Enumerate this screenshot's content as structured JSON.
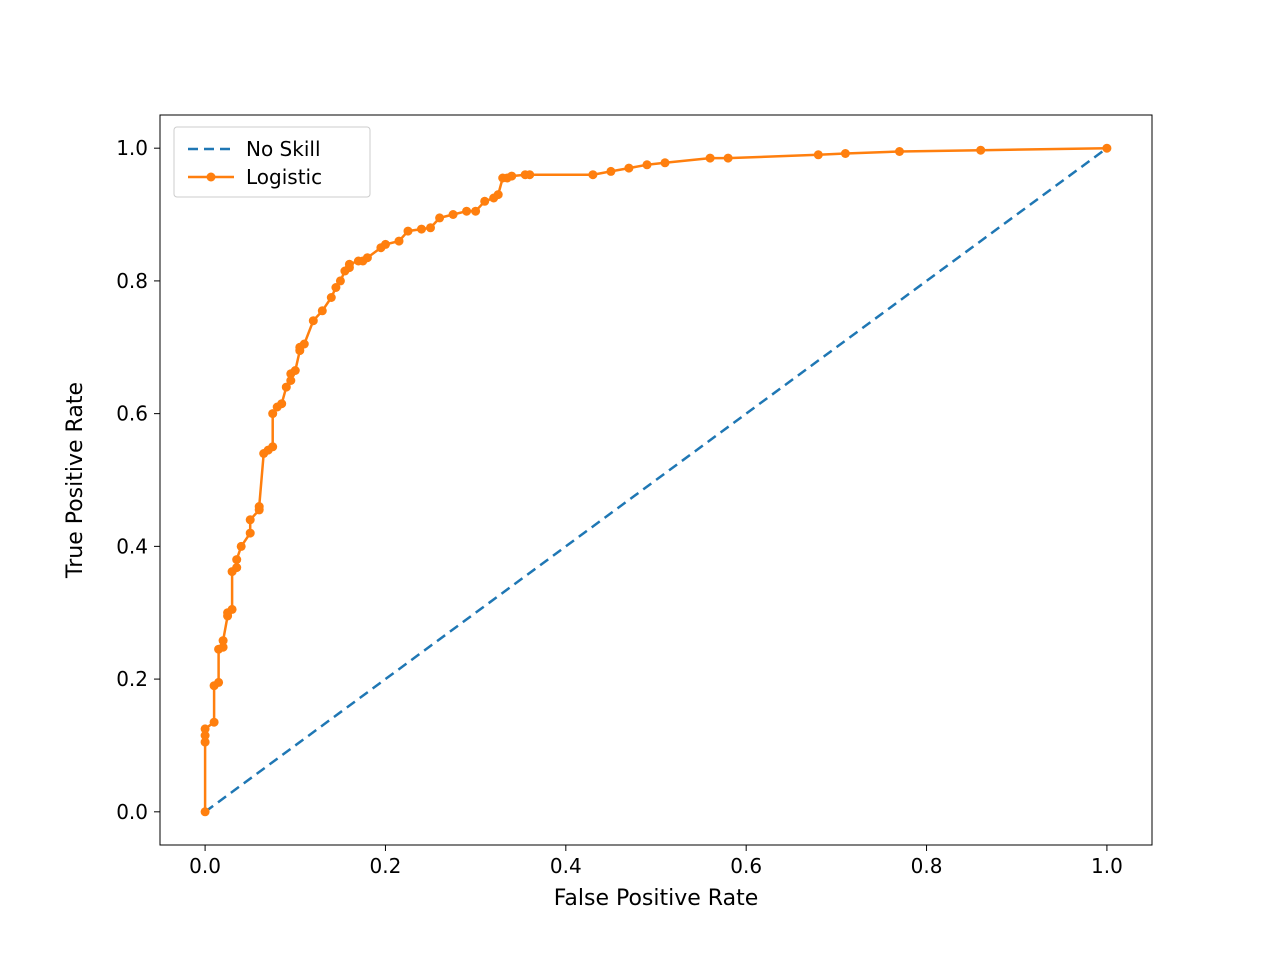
{
  "chart_data": {
    "type": "line",
    "title": "",
    "xlabel": "False Positive Rate",
    "ylabel": "True Positive Rate",
    "xlim": [
      -0.05,
      1.05
    ],
    "ylim": [
      -0.05,
      1.05
    ],
    "xticks": [
      0.0,
      0.2,
      0.4,
      0.6,
      0.8,
      1.0
    ],
    "yticks": [
      0.0,
      0.2,
      0.4,
      0.6,
      0.8,
      1.0
    ],
    "xtick_labels": [
      "0.0",
      "0.2",
      "0.4",
      "0.6",
      "0.8",
      "1.0"
    ],
    "ytick_labels": [
      "0.0",
      "0.2",
      "0.4",
      "0.6",
      "0.8",
      "1.0"
    ],
    "legend": {
      "position": "upper left",
      "entries": [
        "No Skill",
        "Logistic"
      ]
    },
    "series": [
      {
        "name": "No Skill",
        "style": "dashed",
        "color": "#1f77b4",
        "x": [
          0,
          1
        ],
        "y": [
          0,
          1
        ]
      },
      {
        "name": "Logistic",
        "style": "solid-marker",
        "color": "#ff7f0e",
        "x": [
          0.0,
          0.0,
          0.0,
          0.0,
          0.01,
          0.01,
          0.015,
          0.015,
          0.02,
          0.02,
          0.025,
          0.025,
          0.03,
          0.03,
          0.035,
          0.035,
          0.04,
          0.05,
          0.05,
          0.06,
          0.06,
          0.065,
          0.07,
          0.075,
          0.075,
          0.08,
          0.085,
          0.09,
          0.095,
          0.095,
          0.1,
          0.105,
          0.105,
          0.11,
          0.12,
          0.13,
          0.14,
          0.145,
          0.15,
          0.155,
          0.16,
          0.16,
          0.17,
          0.175,
          0.18,
          0.195,
          0.2,
          0.215,
          0.225,
          0.24,
          0.25,
          0.26,
          0.275,
          0.29,
          0.3,
          0.31,
          0.32,
          0.325,
          0.33,
          0.335,
          0.34,
          0.355,
          0.36,
          0.43,
          0.45,
          0.47,
          0.49,
          0.51,
          0.56,
          0.58,
          0.68,
          0.71,
          0.77,
          0.86,
          1.0
        ],
        "y": [
          0.0,
          0.105,
          0.115,
          0.125,
          0.135,
          0.19,
          0.195,
          0.245,
          0.248,
          0.258,
          0.295,
          0.3,
          0.305,
          0.362,
          0.368,
          0.38,
          0.4,
          0.42,
          0.44,
          0.455,
          0.46,
          0.54,
          0.545,
          0.55,
          0.6,
          0.61,
          0.615,
          0.64,
          0.65,
          0.66,
          0.665,
          0.695,
          0.7,
          0.705,
          0.74,
          0.755,
          0.775,
          0.79,
          0.8,
          0.815,
          0.82,
          0.825,
          0.83,
          0.83,
          0.835,
          0.85,
          0.855,
          0.86,
          0.875,
          0.878,
          0.88,
          0.895,
          0.9,
          0.905,
          0.905,
          0.92,
          0.925,
          0.93,
          0.955,
          0.955,
          0.958,
          0.96,
          0.96,
          0.96,
          0.965,
          0.97,
          0.975,
          0.978,
          0.985,
          0.985,
          0.99,
          0.992,
          0.995,
          0.997,
          1.0
        ]
      }
    ]
  }
}
